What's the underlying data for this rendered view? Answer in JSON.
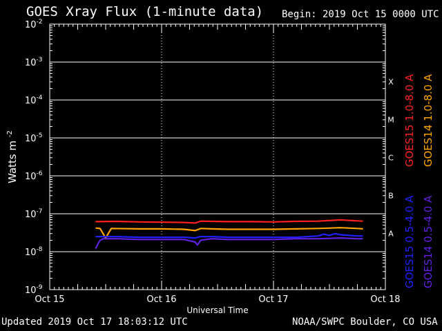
{
  "header": {
    "title": "GOES Xray Flux (1-minute data)",
    "begin": "Begin:  2019 Oct 15 0000 UTC"
  },
  "footer": {
    "updated": "Updated 2019 Oct 17 18:03:12 UTC",
    "credit": "NOAA/SWPC Boulder, CO USA"
  },
  "chart_data": {
    "type": "line",
    "title": "GOES Xray Flux (1-minute data)",
    "xlabel": "Universal Time",
    "ylabel_base": "Watts m",
    "ylabel_exp": "-2",
    "y_scale": "log",
    "ylim": [
      1e-09,
      0.01
    ],
    "xlim": [
      "Oct 15",
      "Oct 18"
    ],
    "x_ticks": [
      "Oct 15",
      "Oct 16",
      "Oct 17",
      "Oct 18"
    ],
    "y_ticks": [
      {
        "base": "10",
        "exp": "-2"
      },
      {
        "base": "10",
        "exp": "-3"
      },
      {
        "base": "10",
        "exp": "-4"
      },
      {
        "base": "10",
        "exp": "-5"
      },
      {
        "base": "10",
        "exp": "-6"
      },
      {
        "base": "10",
        "exp": "-7"
      },
      {
        "base": "10",
        "exp": "-8"
      },
      {
        "base": "10",
        "exp": "-9"
      }
    ],
    "flare_classes": [
      {
        "label": "X",
        "value": 0.0001
      },
      {
        "label": "M",
        "value": 1e-05
      },
      {
        "label": "C",
        "value": 1e-06
      },
      {
        "label": "B",
        "value": 1e-07
      },
      {
        "label": "A",
        "value": 1e-08
      }
    ],
    "grid": true,
    "legend_position": "right",
    "series": [
      {
        "name": "GOES15 1.0-8.0 A",
        "color": "#ff2020",
        "x": [
          0.41,
          0.6,
          0.8,
          1.0,
          1.2,
          1.3,
          1.35,
          1.45,
          1.6,
          1.8,
          2.0,
          2.2,
          2.4,
          2.6,
          2.75,
          2.8
        ],
        "y": [
          6.2e-08,
          6.3e-08,
          6.1e-08,
          6e-08,
          5.9e-08,
          5.7e-08,
          6.4e-08,
          6.3e-08,
          6.2e-08,
          6.2e-08,
          6.1e-08,
          6.3e-08,
          6.4e-08,
          6.9e-08,
          6.5e-08,
          6.4e-08
        ]
      },
      {
        "name": "GOES14 1.0-8.0 A",
        "color": "#ffa500",
        "x": [
          0.41,
          0.45,
          0.5,
          0.55,
          0.8,
          1.0,
          1.2,
          1.3,
          1.35,
          1.45,
          1.6,
          1.8,
          2.0,
          2.2,
          2.4,
          2.6,
          2.75,
          2.8
        ],
        "y": [
          4.2e-08,
          4.1e-08,
          2.3e-08,
          4.1e-08,
          4e-08,
          4e-08,
          3.9e-08,
          3.6e-08,
          4.1e-08,
          4e-08,
          3.9e-08,
          3.9e-08,
          3.9e-08,
          4e-08,
          4.1e-08,
          4.3e-08,
          4.1e-08,
          4e-08
        ]
      },
      {
        "name": "GOES15 0.5-4.0 A",
        "color": "#2020ff",
        "x": [
          0.41,
          0.6,
          0.8,
          1.0,
          1.2,
          1.3,
          1.35,
          1.45,
          1.6,
          1.8,
          2.0,
          2.2,
          2.4,
          2.45,
          2.5,
          2.55,
          2.6,
          2.75,
          2.8
        ],
        "y": [
          2.5e-08,
          2.5e-08,
          2.4e-08,
          2.4e-08,
          2.4e-08,
          2.3e-08,
          2.5e-08,
          2.5e-08,
          2.4e-08,
          2.4e-08,
          2.4e-08,
          2.4e-08,
          2.6e-08,
          2.9e-08,
          2.7e-08,
          3e-08,
          2.8e-08,
          2.6e-08,
          2.6e-08
        ]
      },
      {
        "name": "GOES14 0.5-4.0 A",
        "color": "#6020e0",
        "x": [
          0.41,
          0.43,
          0.45,
          0.48,
          0.5,
          0.6,
          0.8,
          1.0,
          1.2,
          1.3,
          1.32,
          1.35,
          1.45,
          1.6,
          1.8,
          2.0,
          2.2,
          2.4,
          2.6,
          2.75,
          2.8
        ],
        "y": [
          1.2e-08,
          1.6e-08,
          2e-08,
          2.2e-08,
          2.2e-08,
          2.2e-08,
          2.1e-08,
          2.1e-08,
          2.1e-08,
          1.8e-08,
          1.5e-08,
          2e-08,
          2.2e-08,
          2.1e-08,
          2.1e-08,
          2.1e-08,
          2.2e-08,
          2.2e-08,
          2.3e-08,
          2.2e-08,
          2.2e-08
        ]
      }
    ]
  }
}
